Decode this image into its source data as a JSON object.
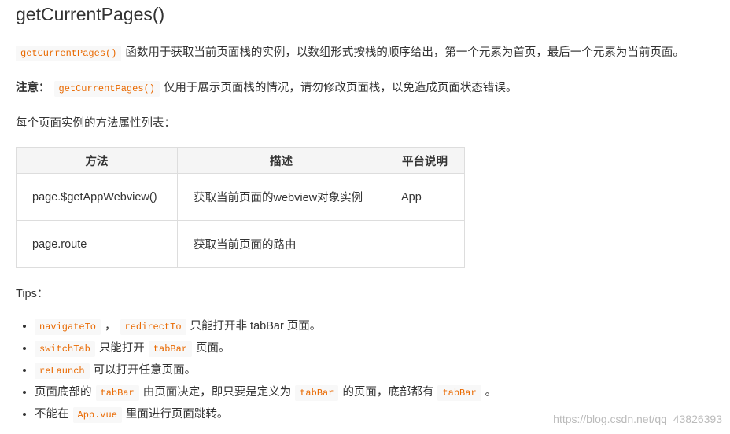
{
  "heading": "getCurrentPages()",
  "intro": {
    "code": "getCurrentPages()",
    "text": "函数用于获取当前页面栈的实例，以数组形式按栈的顺序给出，第一个元素为首页，最后一个元素为当前页面。"
  },
  "note": {
    "label": "注意：",
    "code": "getCurrentPages()",
    "text": "仅用于展示页面栈的情况，请勿修改页面栈，以免造成页面状态错误。"
  },
  "list_intro": "每个页面实例的方法属性列表：",
  "table": {
    "headers": [
      "方法",
      "描述",
      "平台说明"
    ],
    "rows": [
      [
        "page.$getAppWebview()",
        "获取当前页面的webview对象实例",
        "App"
      ],
      [
        "page.route",
        "获取当前页面的路由",
        ""
      ]
    ]
  },
  "tips_label": "Tips：",
  "tips": [
    {
      "c1": "navigateTo",
      "t1": "，",
      "c2": "redirectTo",
      "t2": "只能打开非 tabBar 页面。"
    },
    {
      "c1": "switchTab",
      "t1": "只能打开",
      "c2": "tabBar",
      "t2": "页面。"
    },
    {
      "c1": "reLaunch",
      "t1": "可以打开任意页面。"
    },
    {
      "t0": "页面底部的",
      "c1": "tabBar",
      "t1": "由页面决定，即只要是定义为",
      "c2": "tabBar",
      "t2": "的页面，底部都有",
      "c3": "tabBar",
      "t3": "。"
    },
    {
      "t0": "不能在",
      "c1": "App.vue",
      "t1": "里面进行页面跳转。"
    }
  ],
  "watermark": "https://blog.csdn.net/qq_43826393",
  "colors": {
    "code_text": "#e96900",
    "code_bg": "#f8f8f8",
    "border": "#dddddd",
    "header_bg": "#f5f5f5"
  }
}
